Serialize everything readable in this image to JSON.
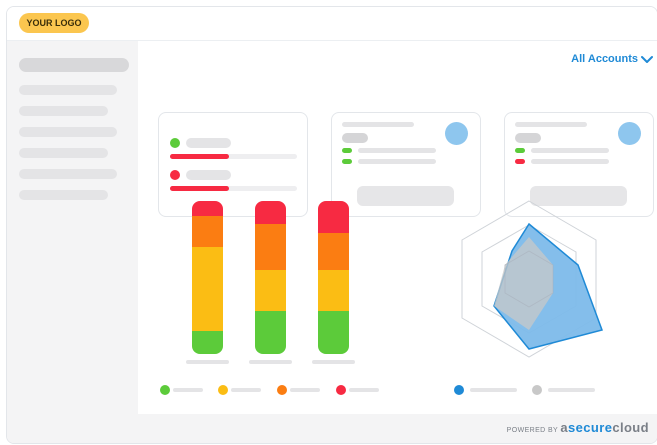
{
  "header": {
    "logo_text": "YOUR LOGO"
  },
  "main": {
    "accounts_label": "All Accounts"
  },
  "footer": {
    "powered_by": "POWERED BY",
    "brand_a": "a",
    "brand_secure": "secure",
    "brand_cloud": "cloud"
  },
  "colors": {
    "green": "#5ccb3a",
    "yellow": "#fbbd14",
    "orange": "#fb7d12",
    "red": "#f72a42",
    "blue": "#1f8ad6",
    "radar_fill": "#7dbbea",
    "gray": "#c8c8c8"
  },
  "bars": [
    {
      "name": "bar-1",
      "segments": {
        "red": 0.1,
        "orange": 0.2,
        "yellow": 0.55,
        "green": 0.15
      }
    },
    {
      "name": "bar-2",
      "segments": {
        "red": 0.15,
        "orange": 0.3,
        "yellow": 0.27,
        "green": 0.28
      }
    },
    {
      "name": "bar-3",
      "segments": {
        "red": 0.21,
        "orange": 0.24,
        "yellow": 0.27,
        "green": 0.28
      }
    }
  ],
  "icons": {
    "accounts_chevron": "chevron-down-icon"
  }
}
